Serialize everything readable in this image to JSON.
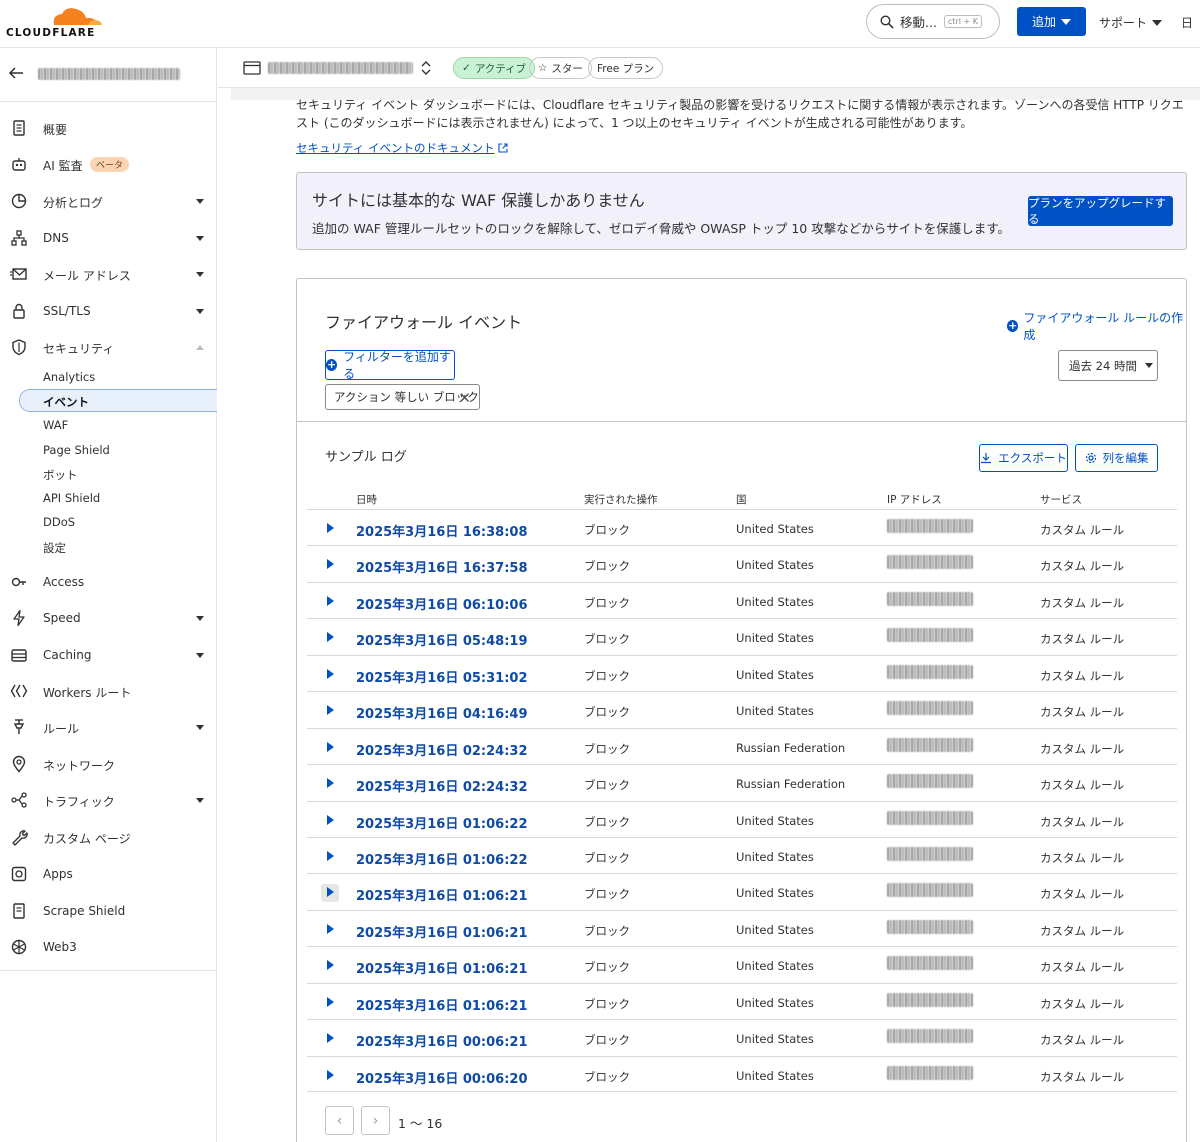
{
  "brand": {
    "name": "CLOUDFLARE",
    "accent": "#f6821f",
    "primary": "#0051c3"
  },
  "topbar": {
    "search_label": "移動...",
    "search_shortcut": "ctrl + K",
    "add_label": "追加",
    "support_label": "サポート",
    "lang_label": "日"
  },
  "zone": {
    "status": "アクティブ",
    "star": "スター",
    "plan": "Free プラン"
  },
  "sidebar": {
    "items": [
      {
        "label": "概要",
        "icon": "document-icon"
      },
      {
        "label": "AI 監査",
        "icon": "robot-icon",
        "badge": "ベータ"
      },
      {
        "label": "分析とログ",
        "icon": "chart-icon"
      },
      {
        "label": "DNS",
        "icon": "network-icon"
      },
      {
        "label": "メール アドレス",
        "icon": "email-icon"
      },
      {
        "label": "SSL/TLS",
        "icon": "lock-icon"
      },
      {
        "label": "セキュリティ",
        "icon": "shield-icon"
      },
      {
        "label": "Access",
        "icon": "access-icon"
      },
      {
        "label": "Speed",
        "icon": "bolt-icon"
      },
      {
        "label": "Caching",
        "icon": "caching-icon"
      },
      {
        "label": "Workers ルート",
        "icon": "workers-icon"
      },
      {
        "label": "ルール",
        "icon": "rules-icon"
      },
      {
        "label": "ネットワーク",
        "icon": "location-icon"
      },
      {
        "label": "トラフィック",
        "icon": "traffic-icon"
      },
      {
        "label": "カスタム ページ",
        "icon": "wrench-icon"
      },
      {
        "label": "Apps",
        "icon": "apps-icon"
      },
      {
        "label": "Scrape Shield",
        "icon": "scrape-icon"
      },
      {
        "label": "Web3",
        "icon": "web3-icon"
      }
    ],
    "security_sub": [
      "Analytics",
      "イベント",
      "WAF",
      "Page Shield",
      "ボット",
      "API Shield",
      "DDoS",
      "設定"
    ]
  },
  "main": {
    "intro": "セキュリティ イベント ダッシュボードには、Cloudflare セキュリティ製品の影響を受けるリクエストに関する情報が表示されます。ゾーンへの各受信 HTTP リクエスト (このダッシュボードには表示されません) によって、1 つ以上のセキュリティ イベントが生成される可能性があります。",
    "doc_link": "セキュリティ イベントのドキュメント",
    "waf_title": "サイトには基本的な WAF 保護しかありません",
    "waf_desc": "追加の WAF 管理ルールセットのロックを解除して、ゼロデイ脅威や OWASP トップ 10 攻撃などからサイトを保護します。",
    "upgrade_label": "プランをアップグレードする"
  },
  "firewall": {
    "title": "ファイアウォール イベント",
    "create_rule": "ファイアウォール ルールの作成",
    "add_filter": "フィルターを追加する",
    "filter_chip": "アクション 等しい ブロック",
    "time_range": "過去 24 時間",
    "log_title": "サンプル ログ",
    "export": "エクスポート",
    "edit_columns": "列を編集",
    "columns": [
      "日時",
      "実行された操作",
      "国",
      "IP アドレス",
      "サービス"
    ],
    "rows": [
      {
        "datetime": "2025年3月16日 16:38:08",
        "action": "ブロック",
        "country": "United States",
        "service": "カスタム ルール"
      },
      {
        "datetime": "2025年3月16日 16:37:58",
        "action": "ブロック",
        "country": "United States",
        "service": "カスタム ルール"
      },
      {
        "datetime": "2025年3月16日 06:10:06",
        "action": "ブロック",
        "country": "United States",
        "service": "カスタム ルール"
      },
      {
        "datetime": "2025年3月16日 05:48:19",
        "action": "ブロック",
        "country": "United States",
        "service": "カスタム ルール"
      },
      {
        "datetime": "2025年3月16日 05:31:02",
        "action": "ブロック",
        "country": "United States",
        "service": "カスタム ルール"
      },
      {
        "datetime": "2025年3月16日 04:16:49",
        "action": "ブロック",
        "country": "United States",
        "service": "カスタム ルール"
      },
      {
        "datetime": "2025年3月16日 02:24:32",
        "action": "ブロック",
        "country": "Russian Federation",
        "service": "カスタム ルール"
      },
      {
        "datetime": "2025年3月16日 02:24:32",
        "action": "ブロック",
        "country": "Russian Federation",
        "service": "カスタム ルール"
      },
      {
        "datetime": "2025年3月16日 01:06:22",
        "action": "ブロック",
        "country": "United States",
        "service": "カスタム ルール"
      },
      {
        "datetime": "2025年3月16日 01:06:22",
        "action": "ブロック",
        "country": "United States",
        "service": "カスタム ルール"
      },
      {
        "datetime": "2025年3月16日 01:06:21",
        "action": "ブロック",
        "country": "United States",
        "service": "カスタム ルール"
      },
      {
        "datetime": "2025年3月16日 01:06:21",
        "action": "ブロック",
        "country": "United States",
        "service": "カスタム ルール"
      },
      {
        "datetime": "2025年3月16日 01:06:21",
        "action": "ブロック",
        "country": "United States",
        "service": "カスタム ルール"
      },
      {
        "datetime": "2025年3月16日 01:06:21",
        "action": "ブロック",
        "country": "United States",
        "service": "カスタム ルール"
      },
      {
        "datetime": "2025年3月16日 00:06:21",
        "action": "ブロック",
        "country": "United States",
        "service": "カスタム ルール"
      },
      {
        "datetime": "2025年3月16日 00:06:20",
        "action": "ブロック",
        "country": "United States",
        "service": "カスタム ルール"
      }
    ],
    "page_range": "1 〜 16"
  }
}
